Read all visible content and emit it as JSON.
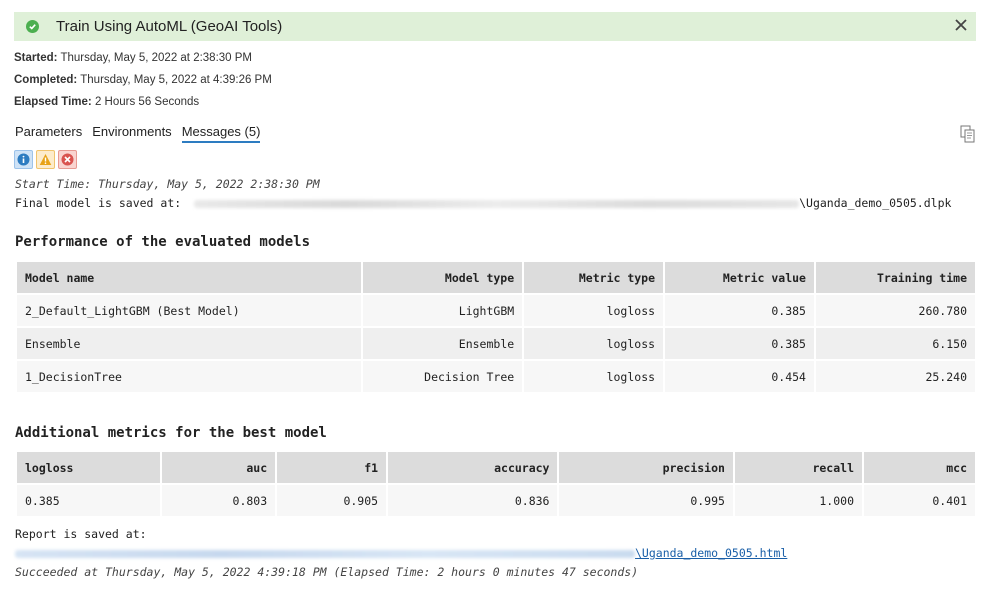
{
  "header": {
    "title": "Train Using AutoML (GeoAI Tools)"
  },
  "meta": {
    "started_label": "Started:",
    "started_value": "Thursday, May 5, 2022 at 2:38:30 PM",
    "completed_label": "Completed:",
    "completed_value": "Thursday, May 5, 2022 at 4:39:26 PM",
    "elapsed_label": "Elapsed Time:",
    "elapsed_value": "2 Hours 56 Seconds"
  },
  "tabs": [
    {
      "label": "Parameters"
    },
    {
      "label": "Environments"
    },
    {
      "label": "Messages (5)"
    }
  ],
  "messages": {
    "start_time": "Start Time: Thursday, May 5, 2022 2:38:30 PM",
    "final_model_prefix": "Final model is saved at:",
    "final_model_suffix": "\\Uganda_demo_0505.dlpk",
    "report_prefix": "Report is saved at:",
    "report_link": "\\Uganda_demo_0505.html",
    "succeeded": "Succeeded at Thursday, May 5, 2022 4:39:18 PM (Elapsed Time: 2 hours 0 minutes 47 seconds)"
  },
  "performance": {
    "title": "Performance of the evaluated models",
    "headers": [
      "Model name",
      "Model type",
      "Metric type",
      "Metric value",
      "Training time"
    ],
    "rows": [
      [
        "2_Default_LightGBM (Best Model)",
        "LightGBM",
        "logloss",
        "0.385",
        "260.780"
      ],
      [
        "Ensemble",
        "Ensemble",
        "logloss",
        "0.385",
        "6.150"
      ],
      [
        "1_DecisionTree",
        "Decision Tree",
        "logloss",
        "0.454",
        "25.240"
      ]
    ]
  },
  "additional": {
    "title": "Additional metrics for the best model",
    "headers": [
      "logloss",
      "auc",
      "f1",
      "accuracy",
      "precision",
      "recall",
      "mcc"
    ],
    "rows": [
      [
        "0.385",
        "0.803",
        "0.905",
        "0.836",
        "0.995",
        "1.000",
        "0.401"
      ]
    ]
  },
  "icons": {
    "success": "check-circle-icon",
    "close": "close-icon",
    "copy": "copy-icon",
    "info": "info-icon",
    "warning": "warning-icon",
    "error": "error-icon"
  }
}
